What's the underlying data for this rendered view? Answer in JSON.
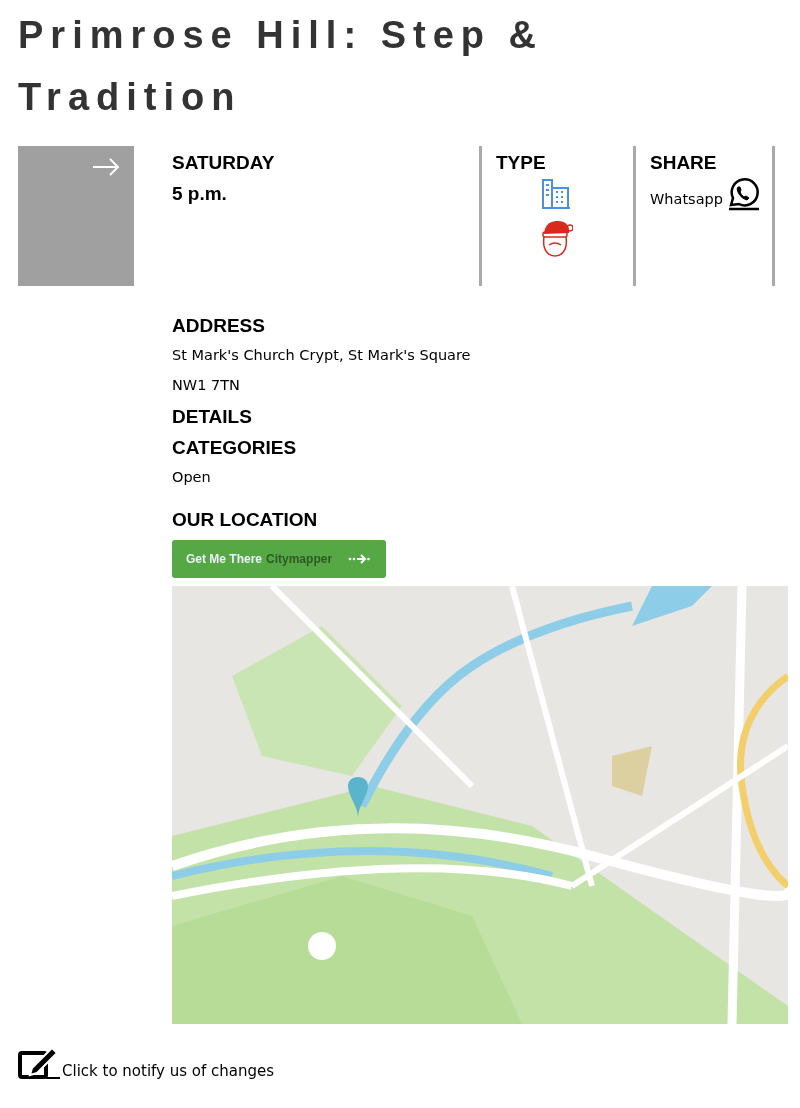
{
  "title": "Primrose Hill: Step & Tradition",
  "when": {
    "day": "SATURDAY",
    "time": "5 p.m."
  },
  "type": {
    "heading": "TYPE"
  },
  "share": {
    "heading": "SHARE",
    "link": "Whatsapp"
  },
  "address": {
    "heading": "ADDRESS",
    "lines": [
      "St Mark's Church Crypt, St Mark's Square",
      "NW1 7TN"
    ]
  },
  "details": {
    "heading": "DETAILS"
  },
  "categories": {
    "heading": "CATEGORIES",
    "items": [
      "Open"
    ]
  },
  "location": {
    "heading": "OUR LOCATION",
    "button": {
      "label": "Get Me There",
      "brand": "Citymapper"
    }
  },
  "notify": "Click to notify us of changes"
}
